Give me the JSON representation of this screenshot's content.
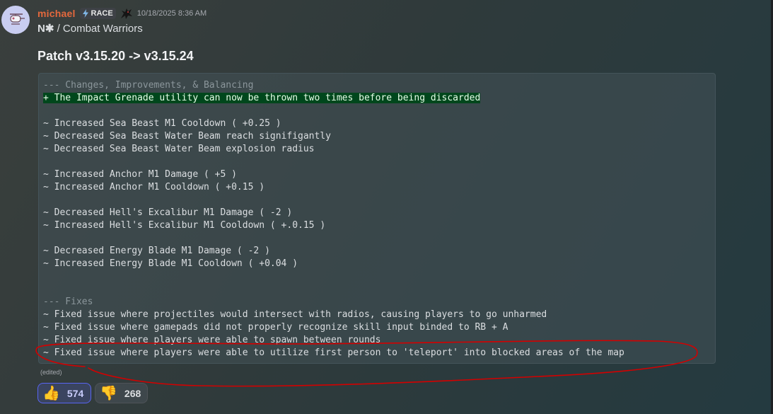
{
  "message": {
    "username": "michael",
    "tag_label": "RACE",
    "timestamp": "10/18/2025 8:36 AM",
    "channel_prefix": "N",
    "channel_star": "✱",
    "channel_suffix": " / Combat Warriors",
    "title": "Patch v3.15.20 -> v3.15.24",
    "edited_label": "(edited)",
    "code_lines": [
      "--- Changes, Improvements, & Balancing",
      "+ The Impact Grenade utility can now be thrown two times before being discarded",
      "",
      "~ Increased Sea Beast M1 Cooldown ( +0.25 )",
      "~ Decreased Sea Beast Water Beam reach signifigantly",
      "~ Decreased Sea Beast Water Beam explosion radius",
      "",
      "~ Increased Anchor M1 Damage ( +5 )",
      "~ Increased Anchor M1 Cooldown ( +0.15 )",
      "",
      "~ Decreased Hell's Excalibur M1 Damage ( -2 )",
      "~ Increased Hell's Excalibur M1 Cooldown ( +.0.15 )",
      "",
      "~ Decreased Energy Blade M1 Damage ( -2 )",
      "~ Increased Energy Blade M1 Cooldown ( +0.04 )",
      "",
      "",
      "--- Fixes",
      "~ Fixed issue where projectiles would intersect with radios, causing players to go unharmed",
      "~ Fixed issue where gamepads did not properly recognize skill input binded to RB + A",
      "~ Fixed issue where players were able to spawn between rounds",
      "~ Fixed issue where players were able to utilize first person to 'teleport' into blocked areas of the map"
    ]
  },
  "reactions": [
    {
      "emoji": "thumbs-up-icon",
      "glyph": "👍",
      "count": "574"
    },
    {
      "emoji": "thumbs-down-icon",
      "glyph": "👎",
      "count": "268"
    }
  ],
  "colors": {
    "username": "#e4683d",
    "diff_added_bg": "#00471c",
    "annotation": "#d40000",
    "reaction_active": "#5865f2"
  }
}
